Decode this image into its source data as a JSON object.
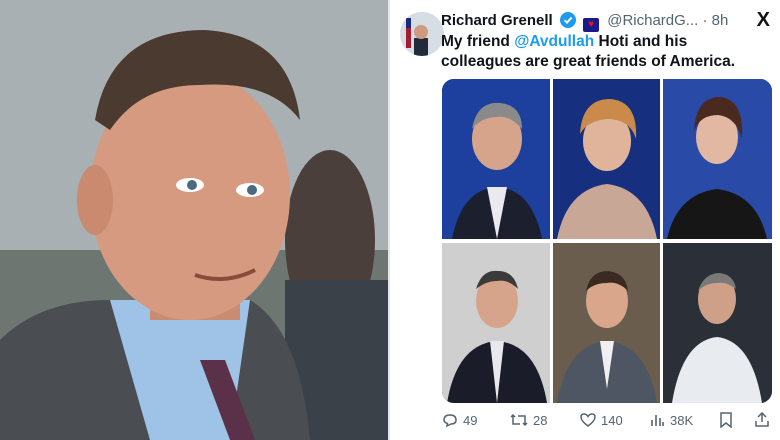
{
  "tweet": {
    "author_name": "Richard Grenell",
    "handle": "@RichardG...",
    "separator": "·",
    "time": "8h",
    "logo_icon": "x-logo-icon",
    "logo_glyph": "X",
    "text_before": "My friend ",
    "mention": "@Avdullah",
    "text_after": " Hoti and his colleagues are great friends of America."
  },
  "actions": {
    "replies": "49",
    "reposts": "28",
    "likes": "140",
    "views": "38K"
  },
  "colors": {
    "accent": "#1d9bf0",
    "text": "#0f1419",
    "muted": "#536471"
  }
}
